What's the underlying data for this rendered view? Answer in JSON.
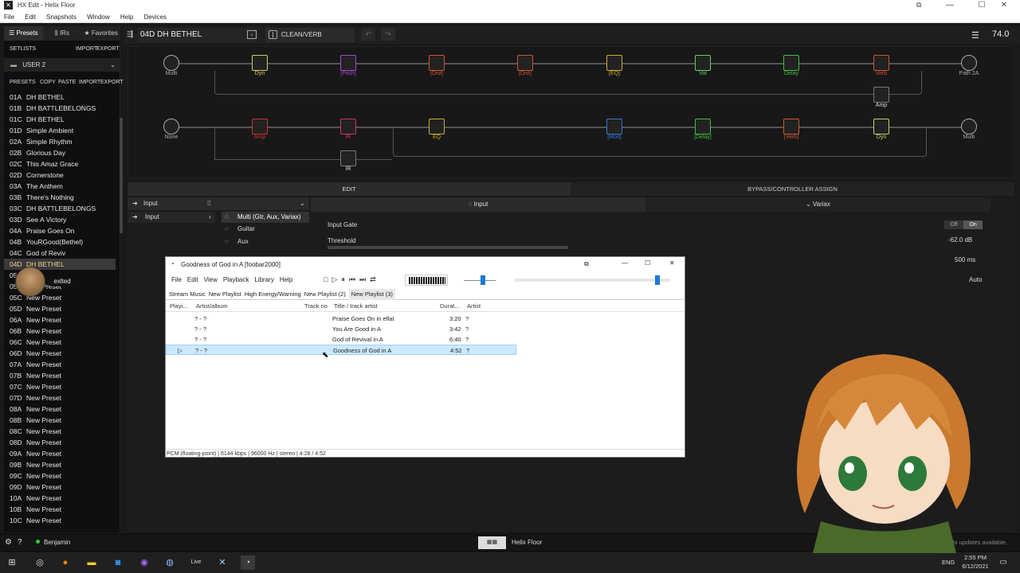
{
  "window": {
    "title": "HX Edit - Helix Floor",
    "minimize": "—",
    "maximize": "☐",
    "close": "✕"
  },
  "menubar": [
    "File",
    "Edit",
    "Snapshots",
    "Window",
    "Help",
    "Devices"
  ],
  "left_panel": {
    "tabs": [
      "Presets",
      "IRs",
      "Favorites"
    ],
    "setlists_label": "SETLISTS",
    "import": "IMPORT",
    "export": "EXPORT",
    "setlist": "USER 2",
    "presets_label": "PRESETS",
    "copy": "COPY",
    "paste": "PASTE",
    "presets": [
      {
        "id": "01A",
        "name": "DH BETHEL"
      },
      {
        "id": "01B",
        "name": "DH BATTLEBELONGS"
      },
      {
        "id": "01C",
        "name": "DH BETHEL"
      },
      {
        "id": "01D",
        "name": "Simple Ambient"
      },
      {
        "id": "02A",
        "name": "Simple Rhythm"
      },
      {
        "id": "02B",
        "name": "Glorious Day"
      },
      {
        "id": "02C",
        "name": "This Amaz Grace"
      },
      {
        "id": "02D",
        "name": "Cornerstone"
      },
      {
        "id": "03A",
        "name": "The Anthem"
      },
      {
        "id": "03B",
        "name": "There's Nothing"
      },
      {
        "id": "03C",
        "name": "DH BATTLEBELONGS"
      },
      {
        "id": "03D",
        "name": "See A Victory"
      },
      {
        "id": "04A",
        "name": "Praise Goes On"
      },
      {
        "id": "04B",
        "name": "YouRGood(Bethel)"
      },
      {
        "id": "04C",
        "name": "God of Reviv"
      },
      {
        "id": "04D",
        "name": "DH BETHEL"
      },
      {
        "id": "05A",
        "name": "Great"
      },
      {
        "id": "05B",
        "name": "New Preset"
      },
      {
        "id": "05C",
        "name": "New Preset"
      },
      {
        "id": "05D",
        "name": "New Preset"
      },
      {
        "id": "06A",
        "name": "New Preset"
      },
      {
        "id": "06B",
        "name": "New Preset"
      },
      {
        "id": "06C",
        "name": "New Preset"
      },
      {
        "id": "06D",
        "name": "New Preset"
      },
      {
        "id": "07A",
        "name": "New Preset"
      },
      {
        "id": "07B",
        "name": "New Preset"
      },
      {
        "id": "07C",
        "name": "New Preset"
      },
      {
        "id": "07D",
        "name": "New Preset"
      },
      {
        "id": "08A",
        "name": "New Preset"
      },
      {
        "id": "08B",
        "name": "New Preset"
      },
      {
        "id": "08C",
        "name": "New Preset"
      },
      {
        "id": "08D",
        "name": "New Preset"
      },
      {
        "id": "09A",
        "name": "New Preset"
      },
      {
        "id": "09B",
        "name": "New Preset"
      },
      {
        "id": "09C",
        "name": "New Preset"
      },
      {
        "id": "09D",
        "name": "New Preset"
      },
      {
        "id": "10A",
        "name": "New Preset"
      },
      {
        "id": "10B",
        "name": "New Preset"
      },
      {
        "id": "10C",
        "name": "New Preset"
      }
    ],
    "overlay_user": "exlted"
  },
  "toolbar": {
    "preset": "04D  DH BETHEL",
    "snapshot": "CLEAN/VERB",
    "tempo": "74.0"
  },
  "signal": {
    "row1": [
      {
        "label": "Multi",
        "color": "#aaaaaa"
      },
      {
        "label": "Dyn",
        "color": "#cccc66"
      },
      {
        "label": "[Pitch]",
        "color": "#aa44cc"
      },
      {
        "label": "[Dist]",
        "color": "#cc5533"
      },
      {
        "label": "[Dist]",
        "color": "#cc5533"
      },
      {
        "label": "[EQ]",
        "color": "#ccaa33"
      },
      {
        "label": "Vol",
        "color": "#66cc66"
      },
      {
        "label": "Delay",
        "color": "#44bb44"
      },
      {
        "label": "Verb",
        "color": "#cc5533"
      },
      {
        "label": "Path 2A",
        "color": "#aaaaaa"
      }
    ],
    "row1_branch": {
      "label": "Amp",
      "color": "#cc3333"
    },
    "row2": [
      {
        "label": "None",
        "color": "#aaaaaa"
      },
      {
        "label": "Amp",
        "color": "#cc3333"
      },
      {
        "label": "IR",
        "color": "#cc3366"
      },
      {
        "label": "EQ",
        "color": "#ccaa33"
      },
      {
        "label": "[Mod]",
        "color": "#3377cc"
      },
      {
        "label": "[Delay]",
        "color": "#44bb44"
      },
      {
        "label": "[Verb]",
        "color": "#cc5533"
      },
      {
        "label": "Dyn",
        "color": "#cccc66"
      },
      {
        "label": "Multi",
        "color": "#aaaaaa"
      }
    ],
    "row2_branch": {
      "label": "IR",
      "color": "#cc3366"
    }
  },
  "edit": {
    "tab_edit": "EDIT",
    "tab_bypass": "BYPASS/CONTROLLER ASSIGN",
    "input_label": "Input",
    "input_row": "Input",
    "sources": [
      "Multi (Gtr, Aux, Variax)",
      "Guitar",
      "Aux",
      "Variax"
    ],
    "panel_title": "Input",
    "variax": "Variax",
    "input_gate": "Input Gate",
    "threshold": "Threshold",
    "off": "Off",
    "on": "On",
    "threshold_value": "-62.0 dB",
    "decay_value": "500 ms",
    "auto_value": "Auto"
  },
  "foobar": {
    "title": "Goodness of God in A  [foobar2000]",
    "menu": [
      "File",
      "Edit",
      "View",
      "Playback",
      "Library",
      "Help"
    ],
    "tabs": [
      "Stream Music",
      "New Playlist",
      "High Energy/Warning",
      "New Playlist (2)",
      "New Playlist (3)"
    ],
    "columns": [
      "Playi...",
      "Artist/album",
      "Track no",
      "Title / track artist",
      "Durat...",
      "Artist"
    ],
    "rows": [
      {
        "playing": "",
        "artist_album": "? - ?",
        "title": "Praise Goes On in eflat",
        "duration": "3:20",
        "artist": "?"
      },
      {
        "playing": "",
        "artist_album": "? - ?",
        "title": "You Are Good in A",
        "duration": "3:42",
        "artist": "?"
      },
      {
        "playing": "",
        "artist_album": "? - ?",
        "title": "God of Revival in A",
        "duration": "6:40",
        "artist": "?"
      },
      {
        "playing": "▷",
        "artist_album": "? - ?",
        "title": "Goodness of God in A",
        "duration": "4:52",
        "artist": "?"
      }
    ],
    "status": "PCM (floating-point) | 6144 kbps | 96000 Hz | stereo | 4:28 / 4:52",
    "volume_level": 0.6,
    "seek_level": 0.92
  },
  "statusline": {
    "user": "Benjamin",
    "device": "Helix Floor",
    "updates": "No updates available."
  },
  "taskbar": {
    "clock_time": "2:55 PM",
    "clock_date": "6/12/2021",
    "lang": "ENG",
    "live": "Live"
  },
  "colors": {
    "accent": "#f0d090",
    "selection": "#cce8ff"
  }
}
